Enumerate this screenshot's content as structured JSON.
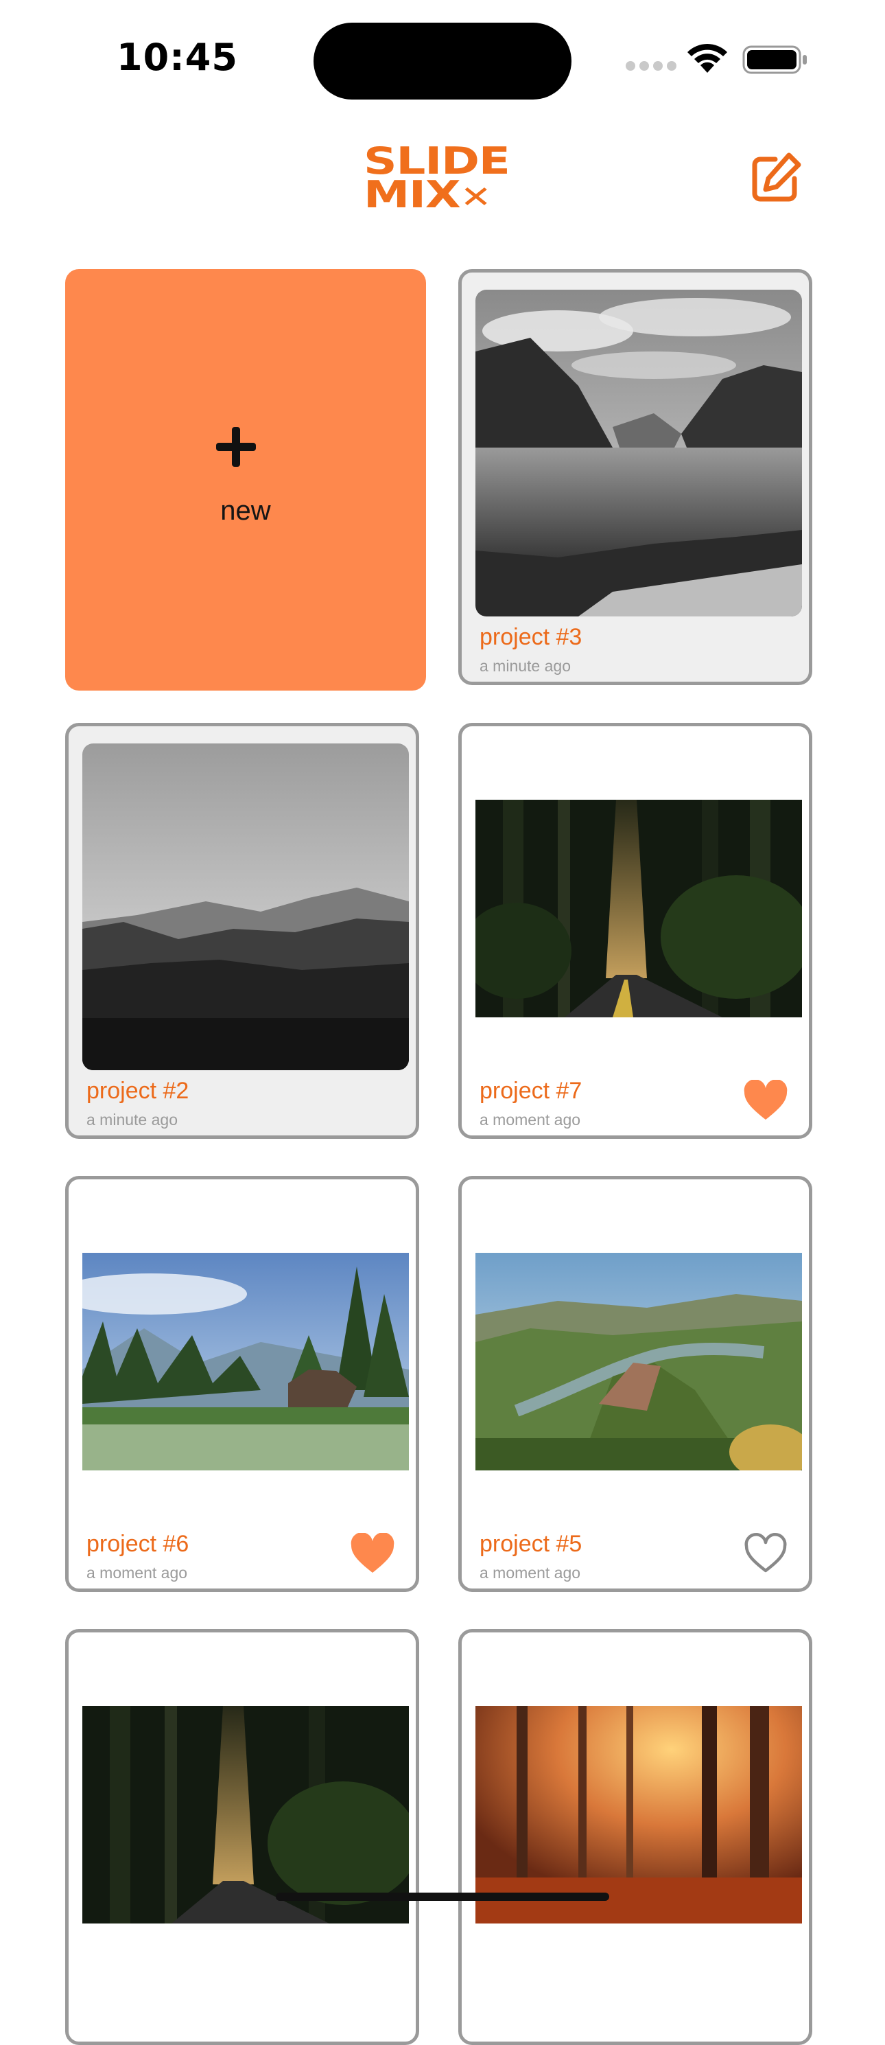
{
  "status_bar": {
    "time": "10:45"
  },
  "header": {
    "logo_line1": "SLIDE",
    "logo_line2": "MIX",
    "logo_suffix": "✕"
  },
  "new_project": {
    "label": "new"
  },
  "projects": [
    {
      "title": "project #3",
      "time": "a minute ago",
      "favorite": null
    },
    {
      "title": "project #2",
      "time": "a minute ago",
      "favorite": null
    },
    {
      "title": "project #7",
      "time": "a moment ago",
      "favorite": true
    },
    {
      "title": "project #6",
      "time": "a moment ago",
      "favorite": true
    },
    {
      "title": "project #5",
      "time": "a moment ago",
      "favorite": false
    }
  ],
  "colors": {
    "accent": "#ec6a1a",
    "new_card": "#fe884d",
    "heart": "#fe884d",
    "card_border": "#9a9a9a"
  }
}
